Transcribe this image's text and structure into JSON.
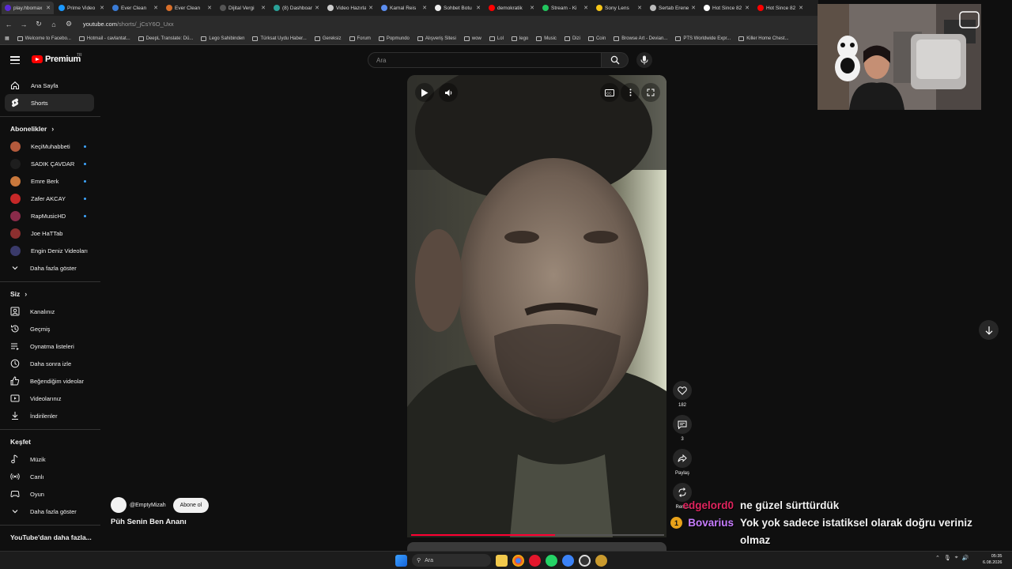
{
  "browser": {
    "tabs": [
      {
        "label": "play.hbomax",
        "color": "#5a2bd6",
        "active": true
      },
      {
        "label": "Prime Video",
        "color": "#1a98ff"
      },
      {
        "label": "Ever Clean",
        "color": "#3a7bd5"
      },
      {
        "label": "Ever Clean",
        "color": "#d86f2a"
      },
      {
        "label": "Dijital Vergi",
        "color": "#555555"
      },
      {
        "label": "(8) Dashboard",
        "color": "#2aa198"
      },
      {
        "label": "Video Hazırla",
        "color": "#cccccc"
      },
      {
        "label": "Kamal Reis",
        "color": "#5b8def"
      },
      {
        "label": "Sohbet Botu",
        "color": "#eeeeee"
      },
      {
        "label": "demokratik",
        "color": "#ff0000"
      },
      {
        "label": "Stream - Ki",
        "color": "#22c55e"
      },
      {
        "label": "Sony Lens",
        "color": "#f5c518"
      },
      {
        "label": "Sertab Erene",
        "color": "#bbbbbb"
      },
      {
        "label": "Hot Since 82",
        "color": "#ffffff"
      },
      {
        "label": "Hot Since 82",
        "color": "#ff0000"
      }
    ],
    "url_host": "youtube.com",
    "url_path": "/shorts/_jCsY6O_Uxx",
    "bookmarks": [
      "Welcome to Facebo...",
      "Hotmail - cavlantat...",
      "DeepL Translate: Dü...",
      "Lego Sahibinden",
      "Türksat Uydu Haber...",
      "Gereksiz",
      "Forum",
      "Popmundo",
      "Alışveriş Sitesi",
      "wow",
      "Lol",
      "lego",
      "Music",
      "Dizi",
      "Coin",
      "Browse Art - Devian...",
      "PTS Worldwide Expr...",
      "Killer Home Chest..."
    ]
  },
  "youtube": {
    "logo_text": "Premium",
    "logo_sup": "TR",
    "search_placeholder": "Ara",
    "sidebar": {
      "main": [
        {
          "label": "Ana Sayfa",
          "icon": "home-icon"
        },
        {
          "label": "Shorts",
          "icon": "shorts-icon",
          "active": true
        }
      ],
      "subscriptions_title": "Abonelikler",
      "subscriptions": [
        {
          "label": "KeçiMuhabbeti",
          "color": "#b35a3c",
          "dot": true
        },
        {
          "label": "SADIK ÇAVDAR",
          "color": "#1e1e1e",
          "dot": true
        },
        {
          "label": "Emre Berk",
          "color": "#c9783c",
          "dot": true
        },
        {
          "label": "Zafer AKCAY",
          "color": "#c62828",
          "dot": true
        },
        {
          "label": "RapMusicHD",
          "color": "#8a2b4a",
          "dot": true
        },
        {
          "label": "Joe HaTTab",
          "color": "#8c2f2f",
          "dot": false
        },
        {
          "label": "Engin Deniz Videoları",
          "color": "#3a3a6a",
          "dot": false
        }
      ],
      "subscriptions_more": "Daha fazla göster",
      "you_title": "Siz",
      "you": [
        {
          "label": "Kanalınız",
          "icon": "channel-icon"
        },
        {
          "label": "Geçmiş",
          "icon": "history-icon"
        },
        {
          "label": "Oynatma listeleri",
          "icon": "playlist-icon"
        },
        {
          "label": "Daha sonra izle",
          "icon": "clock-icon"
        },
        {
          "label": "Beğendiğim videolar",
          "icon": "thumbs-up-icon"
        },
        {
          "label": "Videolarınız",
          "icon": "video-icon"
        },
        {
          "label": "İndirilenler",
          "icon": "download-icon"
        }
      ],
      "explore_title": "Keşfet",
      "explore": [
        {
          "label": "Müzik",
          "icon": "music-icon"
        },
        {
          "label": "Canlı",
          "icon": "live-icon"
        },
        {
          "label": "Oyun",
          "icon": "gaming-icon"
        }
      ],
      "explore_more": "Daha fazla göster",
      "more_from_youtube": "YouTube'dan daha fazla..."
    },
    "short": {
      "channel": "@EmptyMizah",
      "subscribe_label": "Abone ol",
      "title": "Püh Senin Ben Ananı",
      "likes": "182",
      "comments": "3",
      "share_label": "Paylaş",
      "remix_label": "Remix",
      "progress_fraction": 0.57
    }
  },
  "chat": [
    {
      "user": "edgelord0",
      "user_color": "#e0245e",
      "message": "ne güzel sürttürdük"
    },
    {
      "user": "Bovarius",
      "user_color": "#c77dff",
      "badge": "1",
      "message": "Yok yok sadece istatiksel olarak doğru veriniz olmaz"
    }
  ],
  "taskbar": {
    "search_label": "Ara",
    "time": "05:35",
    "date": "6.08.2026"
  }
}
